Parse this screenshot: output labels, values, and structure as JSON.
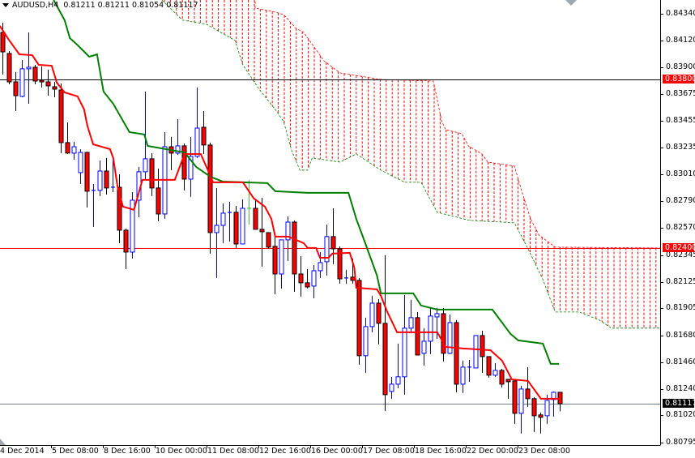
{
  "header": {
    "symbol": "AUDUSD,H4",
    "ohlc": "0.81211 0.81211 0.81054 0.81117"
  },
  "colors": {
    "bull": "#0000ff",
    "bear_fill": "#ff0000",
    "bear_outline": "#000000",
    "tenkan": "#ff0000",
    "kijun": "#008000",
    "cloud": "#ff0000",
    "hline": "#ff0000",
    "price_line": "#708090"
  },
  "chart_data": {
    "type": "candlestick",
    "title": "AUDUSD,H4",
    "ylim": [
      0.80795,
      0.8434
    ],
    "y_ticks": [
      "0.84340",
      "0.84120",
      "0.83900",
      "0.83675",
      "0.83455",
      "0.83235",
      "0.83010",
      "0.82790",
      "0.82570",
      "0.82345",
      "0.82125",
      "0.81905",
      "0.81680",
      "0.81460",
      "0.81240",
      "0.81020",
      "0.80795"
    ],
    "x_labels": [
      "4 Dec 2014",
      "5 Dec 08:00",
      "8 Dec 16:00",
      "10 Dec 00:00",
      "11 Dec 08:00",
      "12 Dec 16:00",
      "16 Dec 00:00",
      "17 Dec 08:00",
      "18 Dec 16:00",
      "22 Dec 00:00",
      "23 Dec 08:00"
    ],
    "candles_ohlc": [
      [
        0.84186,
        0.84266,
        0.83838,
        0.84025
      ],
      [
        0.84012,
        0.84032,
        0.83757,
        0.83777
      ],
      [
        0.83777,
        0.83858,
        0.83536,
        0.83663
      ],
      [
        0.83657,
        0.83958,
        0.8365,
        0.83885
      ],
      [
        0.83885,
        0.84186,
        0.83596,
        0.83898
      ],
      [
        0.83898,
        0.83918,
        0.83757,
        0.83784
      ],
      [
        0.83791,
        0.83905,
        0.8373,
        0.83777
      ],
      [
        0.83777,
        0.83878,
        0.83663,
        0.83744
      ],
      [
        0.83737,
        0.83777,
        0.8365,
        0.83717
      ],
      [
        0.8371,
        0.83764,
        0.83188,
        0.83275
      ],
      [
        0.83275,
        0.83442,
        0.83181,
        0.83188
      ],
      [
        0.83188,
        0.83282,
        0.83134,
        0.83241
      ],
      [
        0.83027,
        0.83221,
        0.82933,
        0.83194
      ],
      [
        0.83194,
        0.83201,
        0.82739,
        0.82873
      ],
      [
        0.82873,
        0.82933,
        0.82578,
        0.8288
      ],
      [
        0.8288,
        0.83127,
        0.82833,
        0.8304
      ],
      [
        0.8304,
        0.83148,
        0.82846,
        0.829
      ],
      [
        0.829,
        0.83127,
        0.82866,
        0.82906
      ],
      [
        0.82906,
        0.83014,
        0.82444,
        0.82551
      ],
      [
        0.82551,
        0.82565,
        0.8223,
        0.8237
      ],
      [
        0.8237,
        0.82866,
        0.82317,
        0.82799
      ],
      [
        0.82799,
        0.83074,
        0.82658,
        0.83034
      ],
      [
        0.83034,
        0.83697,
        0.82967,
        0.83141
      ],
      [
        0.83141,
        0.83188,
        0.82833,
        0.829
      ],
      [
        0.829,
        0.8306,
        0.82625,
        0.82685
      ],
      [
        0.82685,
        0.83362,
        0.82645,
        0.83241
      ],
      [
        0.83241,
        0.83322,
        0.83047,
        0.83188
      ],
      [
        0.83188,
        0.83469,
        0.83174,
        0.83248
      ],
      [
        0.83248,
        0.83268,
        0.8288,
        0.82973
      ],
      [
        0.82973,
        0.83322,
        0.82826,
        0.83161
      ],
      [
        0.83161,
        0.8373,
        0.83148,
        0.83395
      ],
      [
        0.83402,
        0.83536,
        0.83181,
        0.83255
      ],
      [
        0.83255,
        0.83275,
        0.82357,
        0.82531
      ],
      [
        0.82531,
        0.829,
        0.82156,
        0.82591
      ],
      [
        0.82591,
        0.82772,
        0.82444,
        0.82692
      ],
      [
        0.82692,
        0.82786,
        0.82457,
        0.82698
      ],
      [
        0.82699,
        0.82752,
        0.82404,
        0.82437
      ],
      [
        0.82437,
        0.82806,
        0.82437,
        0.82732
      ],
      [
        0.82732,
        0.82967,
        0.82598,
        0.82732
      ],
      [
        0.82732,
        0.82806,
        0.82558,
        0.82558
      ],
      [
        0.82558,
        0.82819,
        0.8225,
        0.82538
      ],
      [
        0.82531,
        0.82531,
        0.82397,
        0.82411
      ],
      [
        0.82417,
        0.82531,
        0.82022,
        0.82189
      ],
      [
        0.82189,
        0.82471,
        0.82069,
        0.82471
      ],
      [
        0.82471,
        0.82665,
        0.82297,
        0.82618
      ],
      [
        0.82618,
        0.82632,
        0.82042,
        0.82189
      ],
      [
        0.82189,
        0.82337,
        0.82002,
        0.82116
      ],
      [
        0.82116,
        0.8223,
        0.82069,
        0.82082
      ],
      [
        0.82089,
        0.82263,
        0.81988,
        0.82216
      ],
      [
        0.82216,
        0.8237,
        0.82156,
        0.82283
      ],
      [
        0.8229,
        0.82598,
        0.82176,
        0.82498
      ],
      [
        0.82498,
        0.82732,
        0.8227,
        0.82397
      ],
      [
        0.82397,
        0.82417,
        0.82109,
        0.82149
      ],
      [
        0.82149,
        0.82223,
        0.82109,
        0.82156
      ],
      [
        0.82163,
        0.82317,
        0.82109,
        0.82136
      ],
      [
        0.82136,
        0.82156,
        0.81439,
        0.81513
      ],
      [
        0.81513,
        0.81828,
        0.81372,
        0.81754
      ],
      [
        0.81754,
        0.82009,
        0.81707,
        0.81948
      ],
      [
        0.81948,
        0.81982,
        0.81607,
        0.81781
      ],
      [
        0.81781,
        0.82344,
        0.81057,
        0.81191
      ],
      [
        0.81218,
        0.81339,
        0.81158,
        0.81278
      ],
      [
        0.81278,
        0.81613,
        0.81245,
        0.81339
      ],
      [
        0.81339,
        0.82015,
        0.81191,
        0.81741
      ],
      [
        0.81741,
        0.81975,
        0.81707,
        0.81828
      ],
      [
        0.81828,
        0.81875,
        0.81519,
        0.81519
      ],
      [
        0.81533,
        0.81741,
        0.81432,
        0.81633
      ],
      [
        0.81633,
        0.81908,
        0.81526,
        0.81841
      ],
      [
        0.81834,
        0.81908,
        0.81653,
        0.81861
      ],
      [
        0.81861,
        0.81908,
        0.81466,
        0.81533
      ],
      [
        0.81533,
        0.81854,
        0.81526,
        0.81787
      ],
      [
        0.81787,
        0.81808,
        0.81211,
        0.81278
      ],
      [
        0.81278,
        0.81473,
        0.81205,
        0.81419
      ],
      [
        0.81419,
        0.81479,
        0.81298,
        0.81419
      ],
      [
        0.81412,
        0.8168,
        0.81412,
        0.8168
      ],
      [
        0.8168,
        0.8172,
        0.81372,
        0.81506
      ],
      [
        0.81506,
        0.81506,
        0.81332,
        0.81352
      ],
      [
        0.81352,
        0.81452,
        0.81339,
        0.81392
      ],
      [
        0.81392,
        0.81406,
        0.81251,
        0.81278
      ],
      [
        0.81318,
        0.81318,
        0.81158,
        0.81298
      ],
      [
        0.81305,
        0.81305,
        0.8095,
        0.81037
      ],
      [
        0.81037,
        0.81265,
        0.8087,
        0.81238
      ],
      [
        0.81238,
        0.81419,
        0.81091,
        0.81158
      ],
      [
        0.81158,
        0.81171,
        0.80883,
        0.81017
      ],
      [
        0.81024,
        0.81044,
        0.8087,
        0.81004
      ],
      [
        0.81017,
        0.81191,
        0.8095,
        0.81144
      ],
      [
        0.81151,
        0.81218,
        0.8101,
        0.81211
      ],
      [
        0.81211,
        0.81211,
        0.81054,
        0.81117
      ]
    ],
    "tenkan_sen": [
      [
        -0.4,
        0.8424
      ],
      [
        0.9,
        0.84132
      ],
      [
        2.6,
        0.84005
      ],
      [
        4.6,
        0.83998
      ],
      [
        5.6,
        0.83918
      ],
      [
        7.6,
        0.83911
      ],
      [
        8.4,
        0.8377
      ],
      [
        9.6,
        0.8369
      ],
      [
        11.6,
        0.83657
      ],
      [
        12.6,
        0.8355
      ],
      [
        13.1,
        0.83416
      ],
      [
        14,
        0.83261
      ],
      [
        16.6,
        0.83221
      ],
      [
        17.1,
        0.83148
      ],
      [
        17.8,
        0.829
      ],
      [
        18.6,
        0.82746
      ],
      [
        20.3,
        0.82719
      ],
      [
        21.6,
        0.82967
      ],
      [
        26.6,
        0.82967
      ],
      [
        28.1,
        0.83181
      ],
      [
        30.6,
        0.83181
      ],
      [
        31.6,
        0.8306
      ],
      [
        32.5,
        0.82947
      ],
      [
        37.1,
        0.82947
      ],
      [
        38.8,
        0.82813
      ],
      [
        40.5,
        0.82746
      ],
      [
        41.5,
        0.82645
      ],
      [
        42.1,
        0.82498
      ],
      [
        44.1,
        0.82498
      ],
      [
        46.5,
        0.82444
      ],
      [
        47.1,
        0.82404
      ],
      [
        48.4,
        0.82404
      ],
      [
        49,
        0.82323
      ],
      [
        50.3,
        0.82323
      ],
      [
        50.9,
        0.82357
      ],
      [
        53.6,
        0.82364
      ],
      [
        54.3,
        0.82243
      ],
      [
        54.6,
        0.82075
      ],
      [
        57.8,
        0.82062
      ],
      [
        58.4,
        0.82009
      ],
      [
        59.4,
        0.81874
      ],
      [
        60.9,
        0.81707
      ],
      [
        67.1,
        0.81707
      ],
      [
        68.4,
        0.81586
      ],
      [
        71.1,
        0.81573
      ],
      [
        75.3,
        0.81559
      ],
      [
        77.1,
        0.81473
      ],
      [
        78.6,
        0.81318
      ],
      [
        81.1,
        0.81305
      ],
      [
        83.1,
        0.81158
      ],
      [
        85.9,
        0.81158
      ]
    ],
    "kijun_sen": [
      [
        7.9,
        0.84454
      ],
      [
        9.6,
        0.84287
      ],
      [
        10.4,
        0.84139
      ],
      [
        11.5,
        0.84086
      ],
      [
        13.4,
        0.83985
      ],
      [
        14.6,
        0.84005
      ],
      [
        15.6,
        0.83697
      ],
      [
        17.1,
        0.83596
      ],
      [
        19.6,
        0.83362
      ],
      [
        21.9,
        0.83342
      ],
      [
        22.4,
        0.83248
      ],
      [
        28.1,
        0.83194
      ],
      [
        28.8,
        0.83148
      ],
      [
        29.9,
        0.83074
      ],
      [
        32.1,
        0.82993
      ],
      [
        34,
        0.82953
      ],
      [
        40.9,
        0.8294
      ],
      [
        42.1,
        0.82873
      ],
      [
        47.1,
        0.8286
      ],
      [
        53.4,
        0.8286
      ],
      [
        54.6,
        0.82645
      ],
      [
        55.9,
        0.82457
      ],
      [
        57.8,
        0.82176
      ],
      [
        58.4,
        0.82029
      ],
      [
        63.4,
        0.82029
      ],
      [
        64.6,
        0.81928
      ],
      [
        67.1,
        0.81895
      ],
      [
        75.6,
        0.81895
      ],
      [
        78.4,
        0.81694
      ],
      [
        79.6,
        0.8164
      ],
      [
        83.4,
        0.81613
      ],
      [
        84.6,
        0.81446
      ],
      [
        85.9,
        0.81446
      ]
    ],
    "senkou_span_a": [
      [
        24.6,
        0.84655
      ],
      [
        39,
        0.84488
      ],
      [
        39,
        0.84387
      ],
      [
        42.1,
        0.84354
      ],
      [
        43.4,
        0.84333
      ],
      [
        45.3,
        0.8422
      ],
      [
        46.5,
        0.84186
      ],
      [
        49.6,
        0.83952
      ],
      [
        52.1,
        0.83851
      ],
      [
        58.4,
        0.83797
      ],
      [
        66.5,
        0.83784
      ],
      [
        67.8,
        0.83449
      ],
      [
        68.4,
        0.83382
      ],
      [
        70.9,
        0.83349
      ],
      [
        71.9,
        0.83248
      ],
      [
        74,
        0.83181
      ],
      [
        74.9,
        0.83114
      ],
      [
        79,
        0.83081
      ],
      [
        80.3,
        0.82846
      ],
      [
        81.5,
        0.82645
      ],
      [
        82.8,
        0.82511
      ],
      [
        85.3,
        0.82411
      ],
      [
        101.5,
        0.82404
      ]
    ],
    "senkou_span_b": [
      [
        24.6,
        0.84454
      ],
      [
        27.8,
        0.84287
      ],
      [
        31.5,
        0.84253
      ],
      [
        35.9,
        0.84119
      ],
      [
        37.1,
        0.83918
      ],
      [
        39.6,
        0.83717
      ],
      [
        42.1,
        0.83549
      ],
      [
        43.4,
        0.83449
      ],
      [
        44.6,
        0.83215
      ],
      [
        45.9,
        0.83047
      ],
      [
        47.1,
        0.83047
      ],
      [
        47.8,
        0.83148
      ],
      [
        52.1,
        0.83114
      ],
      [
        54.6,
        0.83181
      ],
      [
        58.4,
        0.83047
      ],
      [
        62.1,
        0.82947
      ],
      [
        64.6,
        0.82947
      ],
      [
        67.1,
        0.82699
      ],
      [
        72.1,
        0.82632
      ],
      [
        79,
        0.82612
      ],
      [
        80.9,
        0.8242
      ],
      [
        83.4,
        0.82143
      ],
      [
        85.3,
        0.81875
      ],
      [
        89,
        0.81875
      ],
      [
        92.1,
        0.81808
      ],
      [
        94,
        0.81741
      ],
      [
        101.5,
        0.81741
      ]
    ],
    "horizontal_lines": [
      {
        "price": 0.838,
        "label": "0.83800"
      },
      {
        "price": 0.824,
        "label": "0.82400"
      }
    ],
    "current_price": {
      "price": 0.81117,
      "label": "0.81117"
    }
  }
}
